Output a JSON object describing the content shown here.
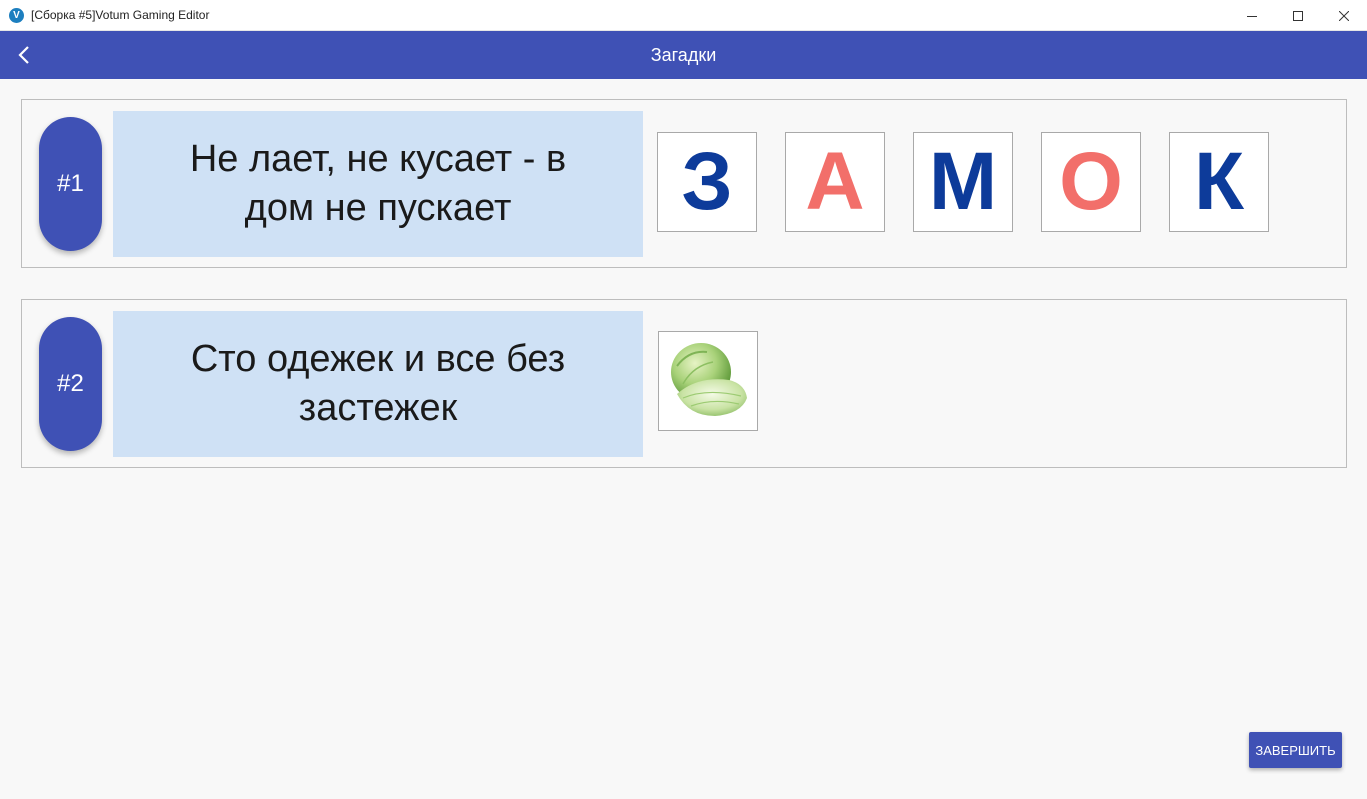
{
  "window": {
    "app_icon_letter": "V",
    "title": "[Сборка #5]Votum Gaming Editor"
  },
  "appbar": {
    "title": "Загадки",
    "back_icon": "chevron-left-icon"
  },
  "riddles": [
    {
      "number": "#1",
      "text": "Не лает, не кусает - в дом не пускает",
      "answer_letters": [
        {
          "char": "З",
          "color": "#0d3b9a"
        },
        {
          "char": "А",
          "color": "#f26f6a"
        },
        {
          "char": "М",
          "color": "#0d3b9a"
        },
        {
          "char": "О",
          "color": "#f26f6a"
        },
        {
          "char": "К",
          "color": "#0d3b9a"
        }
      ]
    },
    {
      "number": "#2",
      "text": "Сто одежек и все без застежек",
      "answer_image": "cabbage-image"
    }
  ],
  "footer": {
    "finish_label": "ЗАВЕРШИТЬ"
  },
  "colors": {
    "primary": "#3f51b5",
    "riddle_bg": "#cfe1f5",
    "letter_blue": "#0d3b9a",
    "letter_coral": "#f26f6a"
  }
}
